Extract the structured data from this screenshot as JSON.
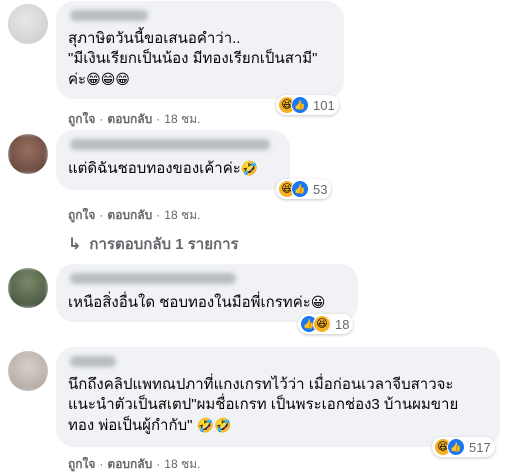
{
  "comments": [
    {
      "lines": [
        "สุภาษิตวันนี้ขอเสนอคำว่า..",
        "\"มีเงินเรียกเป็นน้อง มีทองเรียกเป็นสามี\"",
        "ค่ะ"
      ],
      "emoji_tail": "😁😁😁",
      "reaction_count": "101",
      "like": "ถูกใจ",
      "reply": "ตอบกลับ",
      "time": "18 ชม."
    },
    {
      "lines": [
        "แต่ดิฉันชอบทองของเค้าค่ะ"
      ],
      "emoji_tail": "🤣",
      "reaction_count": "53",
      "like": "ถูกใจ",
      "reply": "ตอบกลับ",
      "time": "18 ชม.",
      "replies_link": "การตอบกลับ 1 รายการ"
    },
    {
      "lines": [
        "เหนือสิ่งอื่นใด ชอบทองในมือพี่เกรทค่ะ"
      ],
      "emoji_tail": "😀",
      "reaction_count": "18"
    },
    {
      "lines": [
        "นึกถึงคลิปแพทณปภาที่แกงเกรทไว้ว่า เมื่อก่อนเวลาจีบสาวจะ",
        "แนะนำตัวเป็นสเตป\"ผมชื่อเกรท เป็นพระเอกช่อง3 บ้านผมขาย",
        "ทอง พ่อเป็นผู้กำกับ\" "
      ],
      "emoji_tail": "🤣🤣",
      "reaction_count": "517",
      "like": "ถูกใจ",
      "reply": "ตอบกลับ",
      "time": "18 ชม."
    }
  ],
  "icons": {
    "reaction_haha": "haha-icon",
    "reaction_like": "like-icon",
    "reply_arrow": "reply-arrow-icon"
  },
  "colors": {
    "bubble": "#f0f2f5",
    "meta": "#65676b",
    "like_blue": "#1877f2",
    "haha_yellow": "#f7b125"
  }
}
